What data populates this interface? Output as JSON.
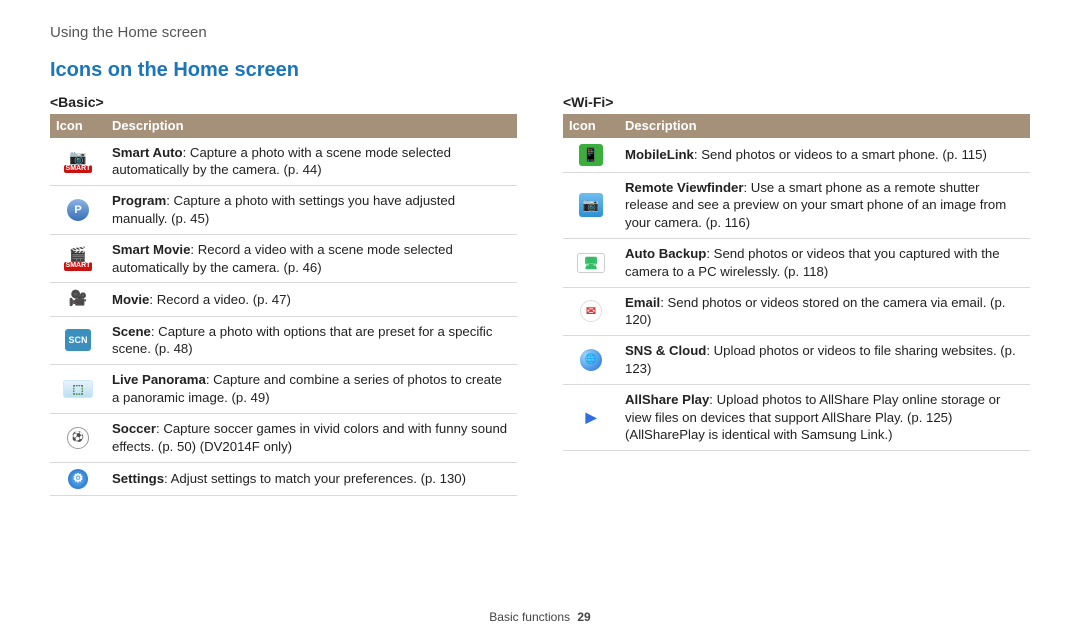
{
  "breadcrumb": "Using the Home screen",
  "section_title": "Icons on the Home screen",
  "table_headers": {
    "icon": "Icon",
    "desc": "Description"
  },
  "left": {
    "subhead": "<Basic>",
    "rows": [
      {
        "icon_name": "smart-auto-icon",
        "title": "Smart Auto",
        "rest": ": Capture a photo with a scene mode selected automatically by the camera. (p. 44)"
      },
      {
        "icon_name": "program-icon",
        "title": "Program",
        "rest": ": Capture a photo with settings you have adjusted manually. (p. 45)"
      },
      {
        "icon_name": "smart-movie-icon",
        "title": "Smart Movie",
        "rest": ": Record a video with a scene mode selected automatically by the camera. (p. 46)"
      },
      {
        "icon_name": "movie-icon",
        "title": "Movie",
        "rest": ": Record a video. (p. 47)"
      },
      {
        "icon_name": "scene-icon",
        "title": "Scene",
        "rest": ": Capture a photo with options that are preset for a specific scene. (p. 48)"
      },
      {
        "icon_name": "panorama-icon",
        "title": "Live Panorama",
        "rest": ": Capture and combine a series of photos to create a panoramic image. (p. 49)"
      },
      {
        "icon_name": "soccer-icon",
        "title": "Soccer",
        "rest": ": Capture soccer games in vivid colors and with funny sound effects. (p. 50) (DV2014F only)"
      },
      {
        "icon_name": "settings-icon",
        "title": "Settings",
        "rest": ": Adjust settings to match your preferences. (p. 130)"
      }
    ]
  },
  "right": {
    "subhead": "<Wi-Fi>",
    "rows": [
      {
        "icon_name": "mobilelink-icon",
        "title": "MobileLink",
        "rest": ": Send photos or videos to a smart phone. (p. 115)"
      },
      {
        "icon_name": "remote-viewfinder-icon",
        "title": "Remote Viewfinder",
        "rest": ": Use a smart phone as a remote shutter release and see a preview on your smart phone of an image from your camera. (p. 116)"
      },
      {
        "icon_name": "auto-backup-icon",
        "title": "Auto Backup",
        "rest": ": Send photos or videos that you captured with the camera to a PC wirelessly. (p. 118)"
      },
      {
        "icon_name": "email-icon",
        "title": "Email",
        "rest": ": Send photos or videos stored on the camera via email. (p. 120)"
      },
      {
        "icon_name": "sns-cloud-icon",
        "title": "SNS & Cloud",
        "rest": ": Upload photos or videos to file sharing websites. (p. 123)"
      },
      {
        "icon_name": "allshare-play-icon",
        "title": "AllShare Play",
        "rest": ": Upload photos to AllShare Play online storage or view files on devices that support AllShare Play. (p. 125) (AllSharePlay is identical with Samsung Link.)"
      }
    ]
  },
  "footer": {
    "section": "Basic functions",
    "page": "29"
  }
}
